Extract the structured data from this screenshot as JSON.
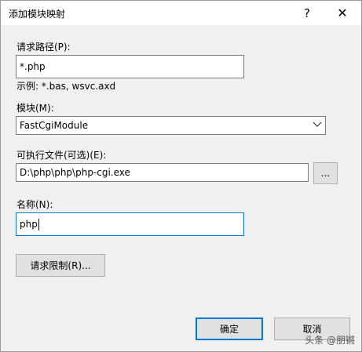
{
  "dialog": {
    "title": "添加模块映射",
    "help_glyph": "?",
    "close_glyph": "✕"
  },
  "request_path": {
    "label": "请求路径(P):",
    "value": "*.php",
    "example": "示例: *.bas, wsvc.axd"
  },
  "module": {
    "label": "模块(M):",
    "value": "FastCgiModule"
  },
  "executable": {
    "label": "可执行文件(可选)(E):",
    "value": "D:\\php\\php\\php-cgi.exe",
    "browse_label": "..."
  },
  "name": {
    "label": "名称(N):",
    "value": "php"
  },
  "restrictions_button": "请求限制(R)...",
  "ok_button": "确定",
  "cancel_button": "取消",
  "watermark": "头条 @朋锵",
  "colors": {
    "focus_border": "#0078d7",
    "dialog_bg": "#f0f0f0",
    "button_bg": "#e1e1e1"
  }
}
